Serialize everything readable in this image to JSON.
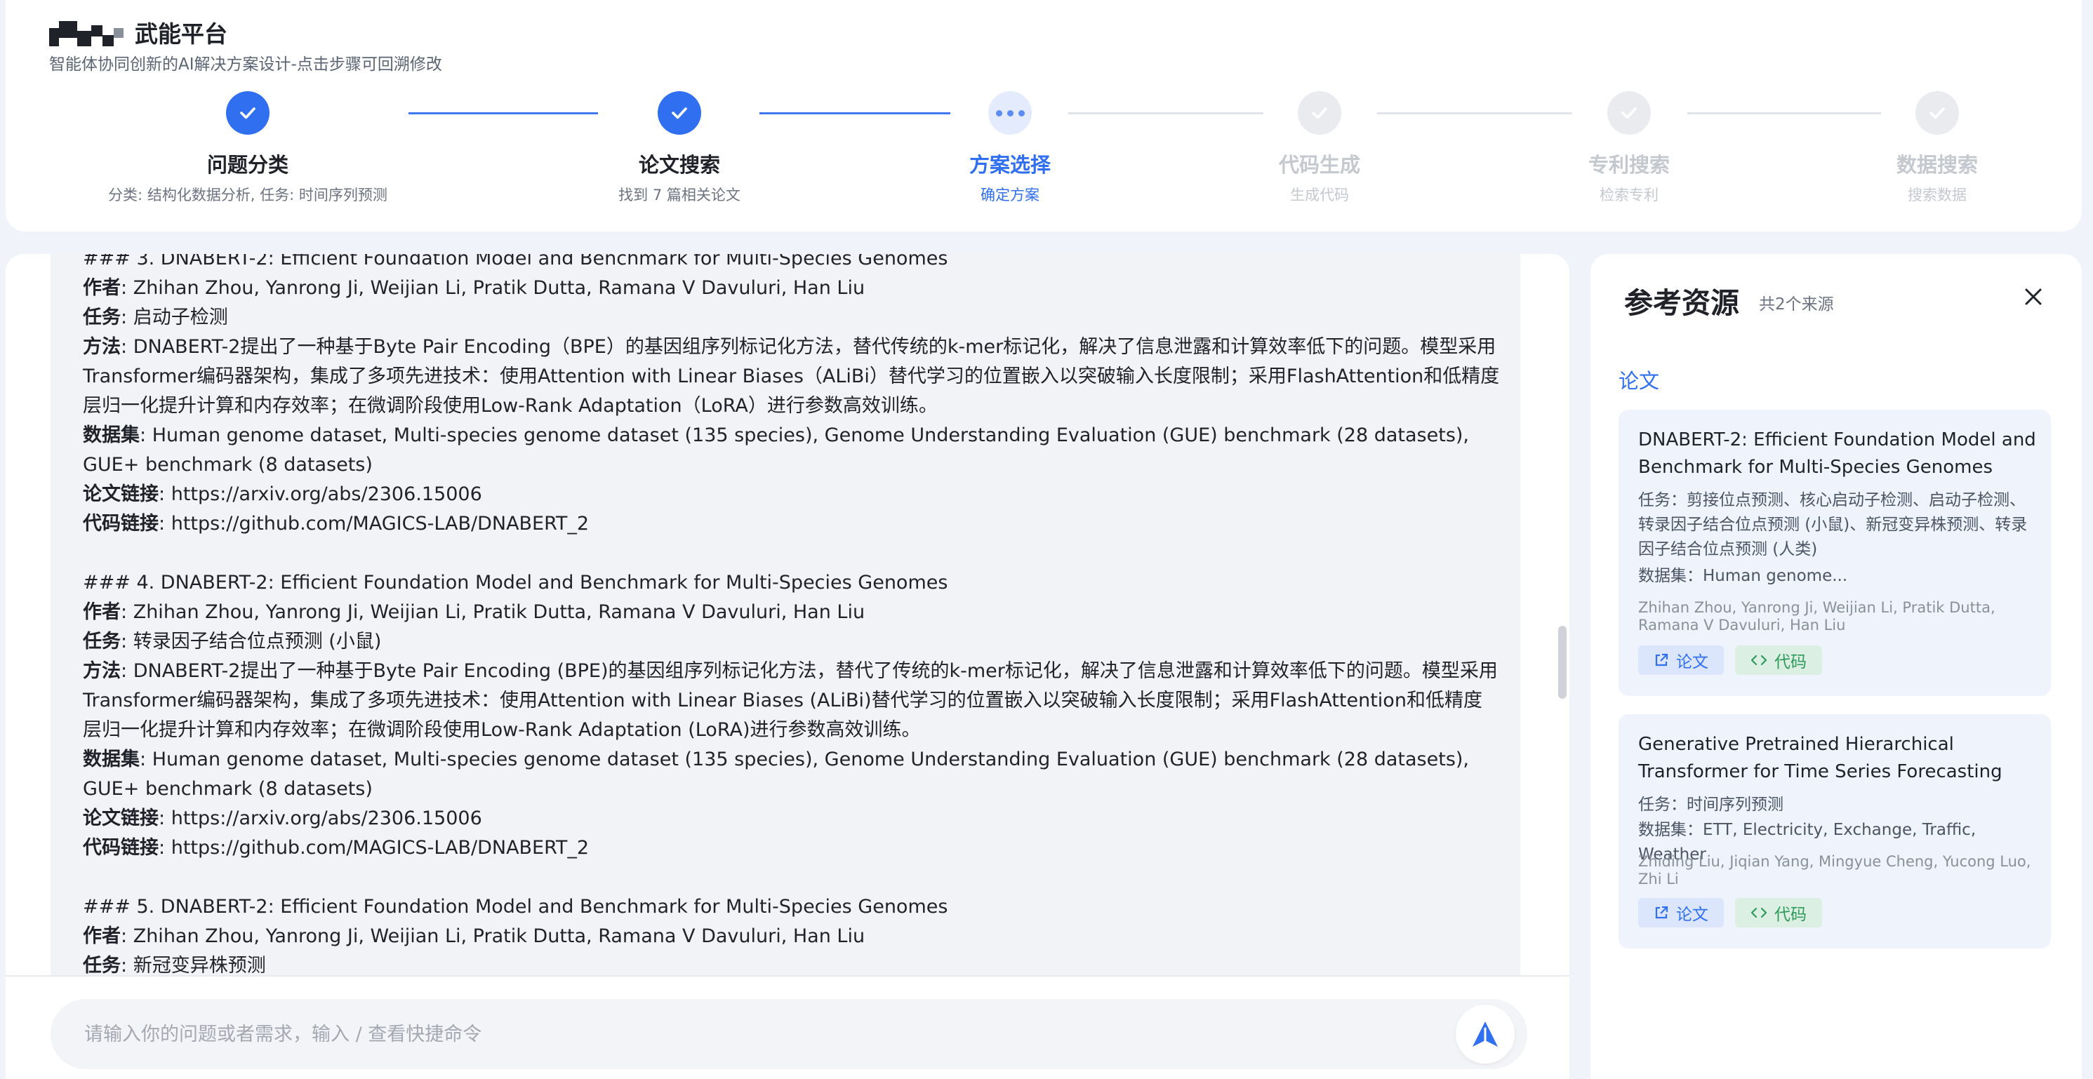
{
  "header": {
    "brand_name": "武能平台",
    "subtitle": "智能体协同创新的AI解决方案设计-点击步骤可回溯修改",
    "steps": [
      {
        "title": "问题分类",
        "desc": "分类: 结构化数据分析, 任务: 时间序列预测",
        "status": "done"
      },
      {
        "title": "论文搜索",
        "desc": "找到 7 篇相关论文",
        "status": "done"
      },
      {
        "title": "方案选择",
        "desc": "确定方案",
        "status": "current"
      },
      {
        "title": "代码生成",
        "desc": "生成代码",
        "status": "pending"
      },
      {
        "title": "专利搜索",
        "desc": "检索专利",
        "status": "pending"
      },
      {
        "title": "数据搜索",
        "desc": "搜索数据",
        "status": "pending"
      }
    ]
  },
  "content": {
    "cut_line": "### 3. DNABERT-2: Efficient Foundation Model and Benchmark for Multi-Species Genomes",
    "labels": {
      "author": "作者",
      "task": "任务",
      "method": "方法",
      "dataset": "数据集",
      "paper_link": "论文链接",
      "code_link": "代码链接",
      "sep": ":"
    },
    "entry3": {
      "authors": "Zhihan Zhou, Yanrong Ji, Weijian Li, Pratik Dutta, Ramana V Davuluri, Han Liu",
      "task": "启动子检测",
      "method": "DNABERT-2提出了一种基于Byte Pair Encoding（BPE）的基因组序列标记化方法，替代传统的k-mer标记化，解决了信息泄露和计算效率低下的问题。模型采用Transformer编码器架构，集成了多项先进技术：使用Attention with Linear Biases（ALiBi）替代学习的位置嵌入以突破输入长度限制；采用FlashAttention和低精度层归一化提升计算和内存效率；在微调阶段使用Low-Rank Adaptation（LoRA）进行参数高效训练。",
      "dataset": "Human genome dataset, Multi-species genome dataset (135 species), Genome Understanding Evaluation (GUE) benchmark (28 datasets), GUE+ benchmark (8 datasets)",
      "paper_link": "https://arxiv.org/abs/2306.15006",
      "code_link": "https://github.com/MAGICS-LAB/DNABERT_2"
    },
    "entry4": {
      "heading": "### 4. DNABERT-2: Efficient Foundation Model and Benchmark for Multi-Species Genomes",
      "authors": "Zhihan Zhou, Yanrong Ji, Weijian Li, Pratik Dutta, Ramana V Davuluri, Han Liu",
      "task": "转录因子结合位点预测 (小鼠)",
      "method": "DNABERT-2提出了一种基于Byte Pair Encoding (BPE)的基因组序列标记化方法，替代了传统的k-mer标记化，解决了信息泄露和计算效率低下的问题。模型采用Transformer编码器架构，集成了多项先进技术：使用Attention with Linear Biases (ALiBi)替代学习的位置嵌入以突破输入长度限制；采用FlashAttention和低精度层归一化提升计算和内存效率；在微调阶段使用Low-Rank Adaptation (LoRA)进行参数高效训练。",
      "dataset": "Human genome dataset, Multi-species genome dataset (135 species), Genome Understanding Evaluation (GUE) benchmark (28 datasets), GUE+ benchmark (8 datasets)",
      "paper_link": "https://arxiv.org/abs/2306.15006",
      "code_link": "https://github.com/MAGICS-LAB/DNABERT_2"
    },
    "entry5": {
      "heading": "### 5. DNABERT-2: Efficient Foundation Model and Benchmark for Multi-Species Genomes",
      "authors": "Zhihan Zhou, Yanrong Ji, Weijian Li, Pratik Dutta, Ramana V Davuluri, Han Liu",
      "task": "新冠变异株预测"
    }
  },
  "input": {
    "placeholder": "请输入你的问题或者需求，输入 / 查看快捷命令"
  },
  "side_panel": {
    "title": "参考资源",
    "count": "共2个来源",
    "section": "论文",
    "task_label": "任务：",
    "dataset_label": "数据集：",
    "paper_btn": "论文",
    "code_btn": "代码",
    "cards": [
      {
        "title": "DNABERT-2: Efficient Foundation Model and Benchmark for Multi-Species Genomes",
        "task": "剪接位点预测、核心启动子检测、启动子检测、转录因子结合位点预测 (小鼠)、新冠变异株预测、转录因子结合位点预测 (人类)",
        "dataset": "Human genome...",
        "authors": "Zhihan Zhou, Yanrong Ji, Weijian Li, Pratik Dutta, Ramana V Davuluri, Han Liu"
      },
      {
        "title": "Generative Pretrained Hierarchical Transformer for Time Series Forecasting",
        "task": "时间序列预测",
        "dataset": "ETT, Electricity, Exchange, Traffic, Weather",
        "authors": "Zhiding Liu, Jiqian Yang, Mingyue Cheng, Yucong Luo, Zhi Li"
      }
    ]
  },
  "colors": {
    "accent": "#2f6ff0",
    "code_green": "#2e9a5a",
    "card_bg": "#eef3fc"
  },
  "icons": {
    "done": "check-icon",
    "current": "ellipsis-icon",
    "send": "send-arrow-icon",
    "close": "close-icon",
    "external": "external-link-icon",
    "code": "code-brackets-icon"
  }
}
